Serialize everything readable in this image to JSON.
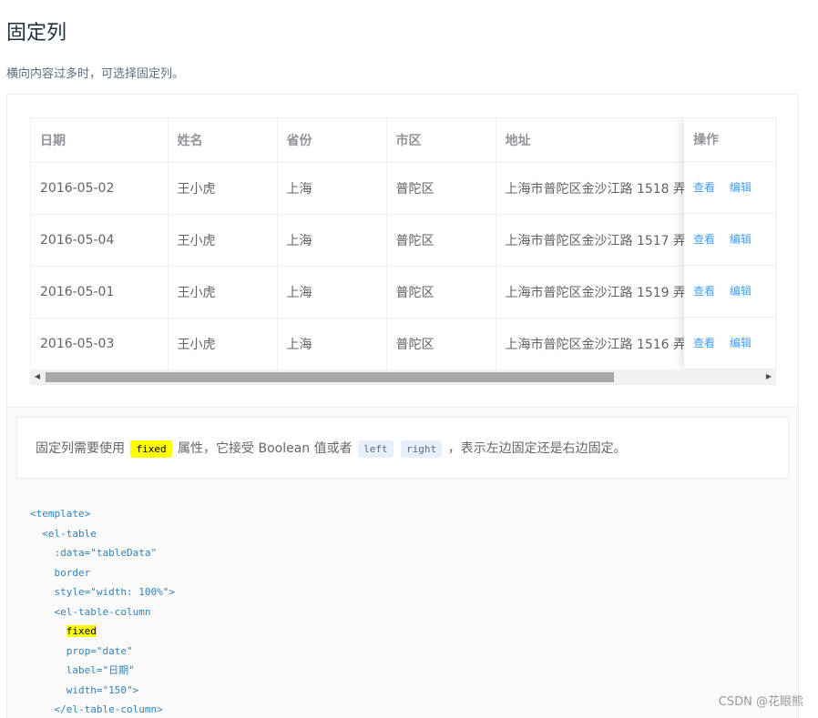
{
  "header": {
    "title": "固定列",
    "description": "横向内容过多时，可选择固定列。"
  },
  "table": {
    "columns": [
      "日期",
      "姓名",
      "省份",
      "市区",
      "地址"
    ],
    "action_column": "操作",
    "rows": [
      {
        "date": "2016-05-02",
        "name": "王小虎",
        "province": "上海",
        "city": "普陀区",
        "address": "上海市普陀区金沙江路 1518 弄"
      },
      {
        "date": "2016-05-04",
        "name": "王小虎",
        "province": "上海",
        "city": "普陀区",
        "address": "上海市普陀区金沙江路 1517 弄"
      },
      {
        "date": "2016-05-01",
        "name": "王小虎",
        "province": "上海",
        "city": "普陀区",
        "address": "上海市普陀区金沙江路 1519 弄"
      },
      {
        "date": "2016-05-03",
        "name": "王小虎",
        "province": "上海",
        "city": "普陀区",
        "address": "上海市普陀区金沙江路 1516 弄"
      }
    ],
    "actions": {
      "view": "查看",
      "edit": "编辑"
    },
    "scrollbar": {
      "left_arrow": "◀",
      "right_arrow": "▶"
    }
  },
  "meta": {
    "desc_before": "固定列需要使用",
    "desc_code_fixed": "fixed",
    "desc_middle": "属性，它接受 Boolean 值或者",
    "desc_code_left": "left",
    "desc_code_right": "right",
    "desc_after": "，表示左边固定还是右边固定。"
  },
  "code": {
    "lines": [
      "<template>",
      "  <el-table",
      "    :data=\"tableData\"",
      "    border",
      "    style=\"width: 100%\">",
      "    <el-table-column",
      "      fixed",
      "      prop=\"date\"",
      "      label=\"日期\"",
      "      width=\"150\">",
      "    </el-table-column>"
    ]
  },
  "watermark": "CSDN @花眼熊"
}
